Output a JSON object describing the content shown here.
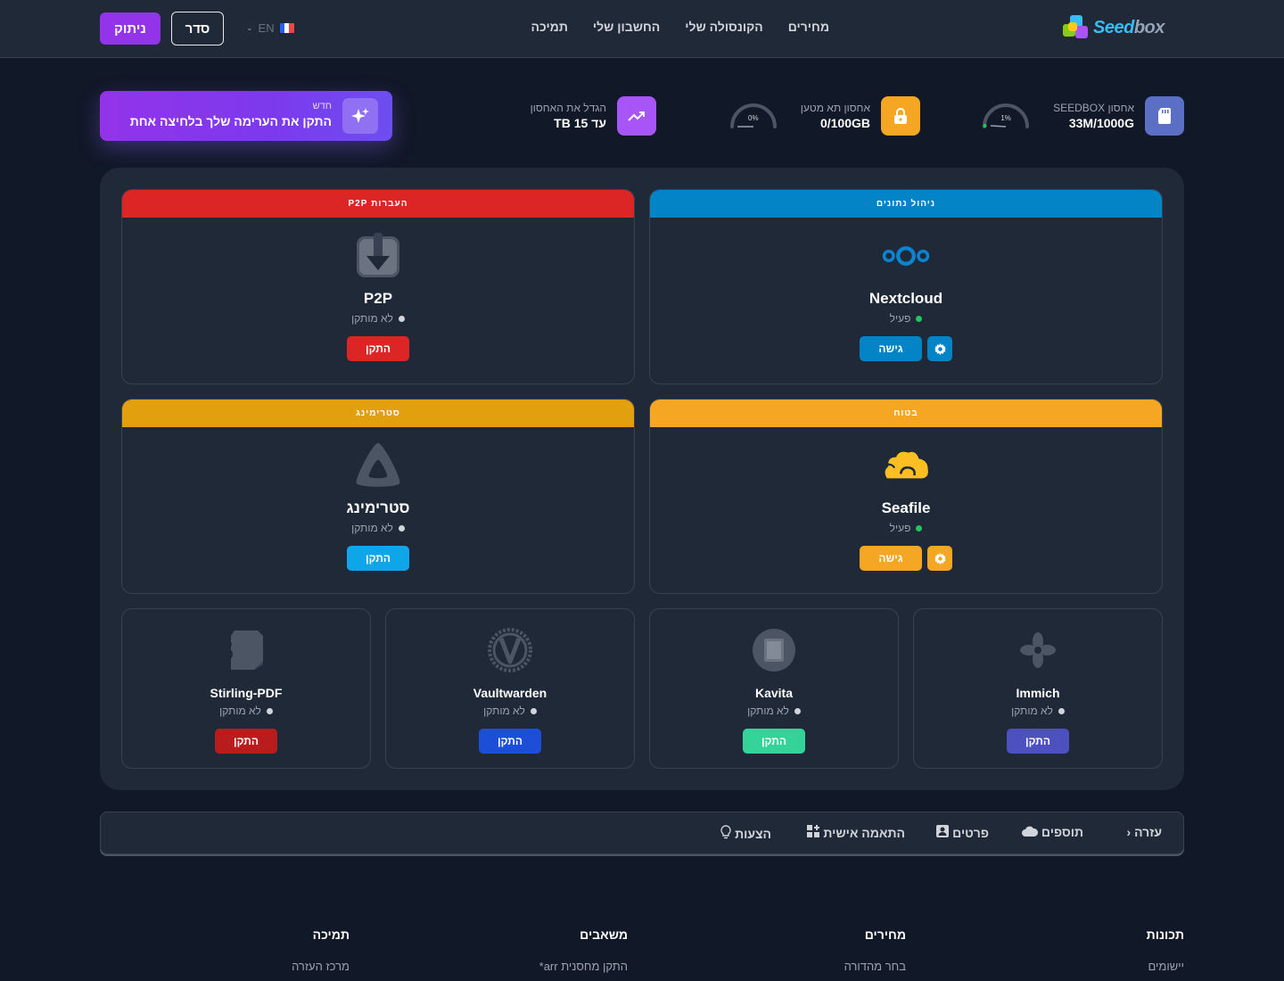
{
  "nav": {
    "logo_text_a": "Seed",
    "logo_text_b": "box",
    "links": [
      "מחירים",
      "הקונסולה שלי",
      "החשבון שלי",
      "תמיכה"
    ],
    "lang_code": "EN",
    "arrange_label": "סדר",
    "logout_label": "ניתוק"
  },
  "stats": {
    "seedbox": {
      "label": "אחסון SEEDBOX",
      "value": "33M/1000G",
      "gauge": "1%",
      "percent": 1
    },
    "locker": {
      "label": "אחסון תא מטען",
      "value": "0/100GB",
      "gauge": "0%",
      "percent": 0
    },
    "upgrade": {
      "label": "הגדל את האחסון",
      "value": "עד 15 TB"
    }
  },
  "promo": {
    "small": "חדש",
    "main": "התקן את הערימה שלך בלחיצה אחת"
  },
  "cards": {
    "data_mgmt": {
      "category": "ניהול נתונים",
      "name": "Nextcloud",
      "status": "פעיל",
      "action": "גישה"
    },
    "p2p": {
      "category": "העברות P2P",
      "name": "P2P",
      "status": "לא מותקן",
      "action": "התקן"
    },
    "secure": {
      "category": "בטוח",
      "name": "Seafile",
      "status": "פעיל",
      "action": "גישה"
    },
    "streaming": {
      "category": "סטרימינג",
      "name": "סטרימינג",
      "status": "לא מותקן",
      "action": "התקן"
    },
    "immich": {
      "name": "Immich",
      "status": "לא מותקן",
      "action": "התקן"
    },
    "kavita": {
      "name": "Kavita",
      "status": "לא מותקן",
      "action": "התקן"
    },
    "vaultwarden": {
      "name": "Vaultwarden",
      "status": "לא מותקן",
      "action": "התקן"
    },
    "stirling": {
      "name": "Stirling-PDF",
      "status": "לא מותקן",
      "action": "התקן"
    }
  },
  "tabs": [
    "עזרה",
    "תוספים",
    "פרטים",
    "התאמה אישית",
    "הצעות"
  ],
  "footer": [
    {
      "title": "תכונות",
      "link": "יישומים"
    },
    {
      "title": "מחירים",
      "link": "בחר מהדורה"
    },
    {
      "title": "משאבים",
      "link": "התקן מחסנית arr*"
    },
    {
      "title": "תמיכה",
      "link": "מרכז העזרה"
    }
  ],
  "colors": {
    "blue": "#0284c7",
    "red": "#dc2626",
    "amber_dark": "#e3a00e",
    "amber": "#f5a623",
    "purple": "#9333ea",
    "indigo": "#4c51bf",
    "green": "#22c55e"
  }
}
